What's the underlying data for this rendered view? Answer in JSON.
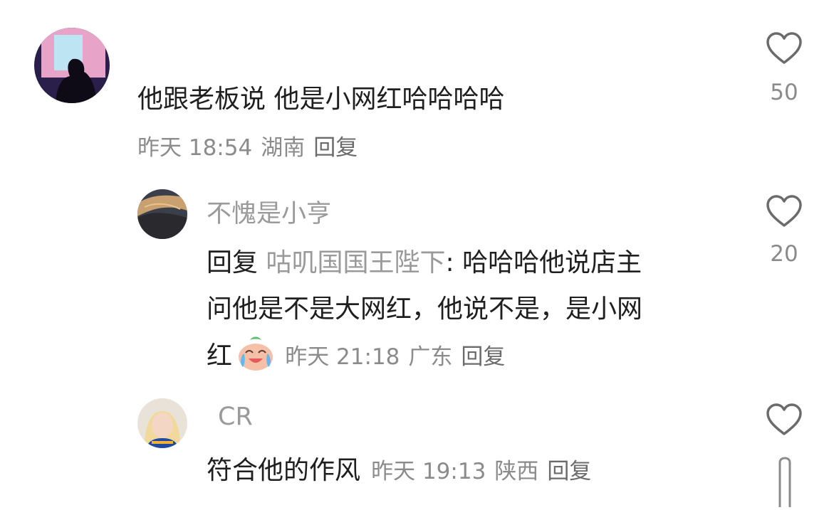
{
  "comments": [
    {
      "text": "他跟老板说 他是小网红哈哈哈哈",
      "time": "昨天 18:54",
      "location": "湖南",
      "reply_label": "回复",
      "likes": "50"
    }
  ],
  "replies": [
    {
      "username": "不愧是小亨",
      "reply_prefix": "回复",
      "reply_to": "咕叽国国王陛下",
      "text_line1": "哈哈哈他说店主",
      "text_line2": "问他是不是大网红，他说不是，是小网",
      "text_line3": "红",
      "emoji": "crying-laughing-emoji",
      "time": "昨天 21:18",
      "location": "广东",
      "reply_label": "回复",
      "likes": "20"
    },
    {
      "username": "CR",
      "text": "符合他的作风",
      "time": "昨天 19:13",
      "location": "陕西",
      "reply_label": "回复",
      "likes": ""
    }
  ],
  "colors": {
    "text": "#1f1f1f",
    "muted": "#8b8b8b",
    "username": "#9a9a9a",
    "heart": "#6b6b6b"
  }
}
